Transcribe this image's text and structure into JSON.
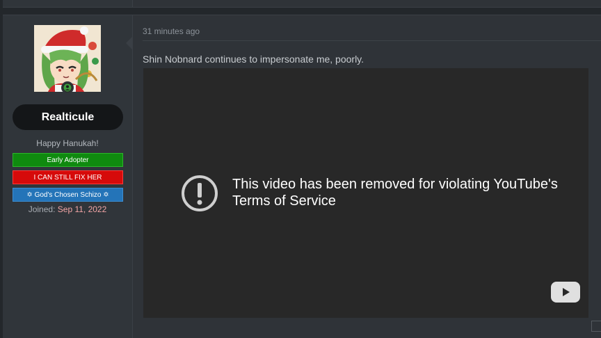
{
  "user": {
    "username": "Realticule",
    "title": "Happy Hanukah!",
    "banners": [
      {
        "label": "Early Adopter",
        "color": "#0f8a0f"
      },
      {
        "label": "I CAN STILL FIX HER",
        "color": "#d60a0a"
      },
      {
        "label": "✡ God's Chosen Schizo ✡",
        "color": "#2474b8"
      }
    ],
    "joined_label": "Joined:",
    "joined_date": "Sep 11, 2022",
    "online": true
  },
  "post": {
    "timestamp": "31 minutes ago",
    "message": "Shin Nobnard continues to impersonate me, poorly.",
    "video": {
      "error_text": "This video has been removed for violating YouTube's Terms of Service",
      "error_icon": "exclamation-circle-icon",
      "logo_icon": "youtube-icon"
    }
  }
}
